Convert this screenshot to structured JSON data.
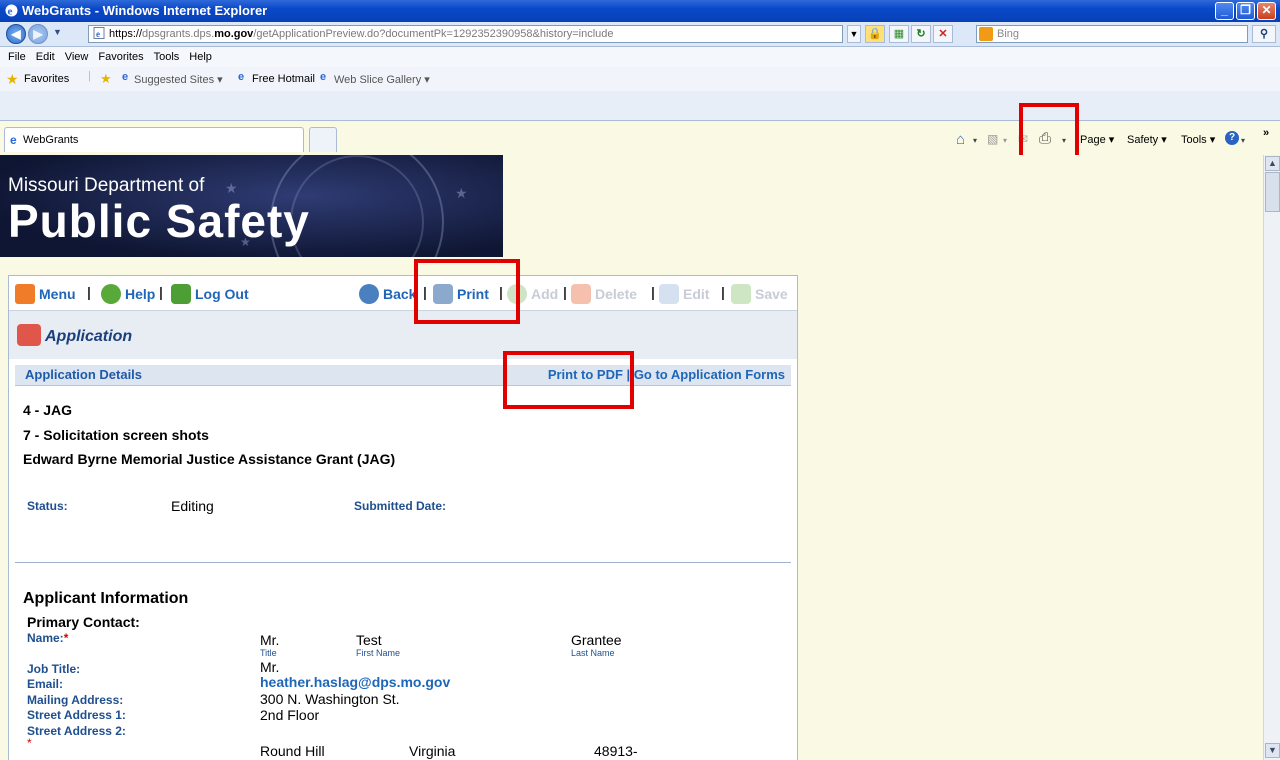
{
  "window": {
    "title": "WebGrants - Windows Internet Explorer",
    "min": "_",
    "max": "❐",
    "close": "✕"
  },
  "address": {
    "protocol": "https://",
    "host_pre": "dpsgrants.dps.",
    "host_bold": "mo.gov",
    "path": "/getApplicationPreview.do?documentPk=1292352390958&history=include",
    "search_placeholder": "Bing"
  },
  "menubar": [
    "File",
    "Edit",
    "View",
    "Favorites",
    "Tools",
    "Help"
  ],
  "favorites": {
    "label": "Favorites",
    "items": [
      "Suggested Sites ▾",
      "Free Hotmail",
      "Web Slice Gallery ▾"
    ]
  },
  "tab": {
    "label": "WebGrants"
  },
  "commandbar": {
    "page": "Page ▾",
    "safety": "Safety ▾",
    "tools": "Tools ▾",
    "more": "»"
  },
  "banner": {
    "line1": "Missouri Department of",
    "line2": "Public Safety"
  },
  "toolbar": {
    "menu": "Menu",
    "help": "Help",
    "logout": "Log Out",
    "back": "Back",
    "print": "Print",
    "add": "Add",
    "delete": "Delete",
    "edit": "Edit",
    "save": "Save",
    "sep": "|"
  },
  "app": {
    "header": "Application",
    "details_title": "Application Details",
    "print_pdf": "Print to PDF",
    "goto_forms": "Go to Application Forms",
    "line1": "4 - JAG",
    "line2": "7 - Solicitation screen shots",
    "line3": "Edward Byrne Memorial Justice Assistance Grant (JAG)",
    "status_label": "Status:",
    "status_value": "Editing",
    "submitted_label": "Submitted Date:",
    "submitted_value": ""
  },
  "applicant": {
    "section": "Applicant Information",
    "primary": "Primary Contact:",
    "name_label": "Name:",
    "req": "*",
    "title_val": "Mr.",
    "first_val": "Test",
    "last_val": "Grantee",
    "title_cap": "Title",
    "first_cap": "First Name",
    "last_cap": "Last Name",
    "job_label": "Job Title:",
    "job_val": "Mr.",
    "email_label": "Email:",
    "email_val": "heather.haslag@dps.mo.gov",
    "mail_label": "Mailing Address:",
    "mail_val": "300 N. Washington St.",
    "street1_label": "Street Address 1:",
    "street1_val": "2nd Floor",
    "street2_label": "Street Address 2:",
    "city_val": "Round Hill",
    "state_val": "Virginia",
    "zip_val": "48913-"
  },
  "colors": {
    "titlebar": "#0a48c8",
    "link": "#1f66b8",
    "highlight": "#e00000",
    "page_bg": "#f9f9e4"
  }
}
